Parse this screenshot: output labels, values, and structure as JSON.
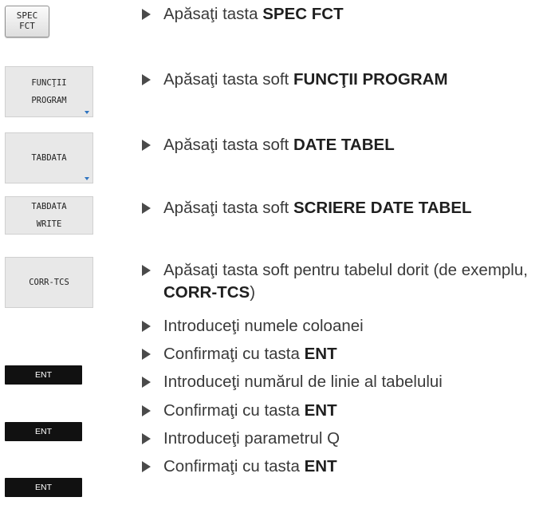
{
  "keys": {
    "spec_fct": {
      "line1": "SPEC",
      "line2": "FCT"
    },
    "program_functions": {
      "line1": "FUNCŢII",
      "line2": "PROGRAM"
    },
    "tabdata": {
      "line1": "TABDATA"
    },
    "tabdata_write": {
      "line1": "TABDATA",
      "line2": "WRITE"
    },
    "corr_tcs": {
      "line1": "CORR-TCS"
    },
    "ent": "ENT"
  },
  "steps": [
    {
      "text": "Apăsaţi tasta ",
      "bold": "SPEC FCT",
      "after": ""
    },
    {
      "text": "Apăsaţi tasta soft ",
      "bold": "FUNCŢII PROGRAM",
      "after": ""
    },
    {
      "text": "Apăsaţi tasta soft ",
      "bold": "DATE TABEL",
      "after": ""
    },
    {
      "text": "Apăsaţi tasta soft ",
      "bold": "SCRIERE DATE TABEL",
      "after": ""
    },
    {
      "text": "Apăsaţi tasta soft pentru tabelul dorit (de exemplu, ",
      "bold": "CORR-TCS",
      "after": ")"
    },
    {
      "text": "Introduceţi numele coloanei",
      "bold": "",
      "after": ""
    },
    {
      "text": "Confirmaţi cu tasta ",
      "bold": "ENT",
      "after": ""
    },
    {
      "text": "Introduceţi numărul de linie al tabelului",
      "bold": "",
      "after": ""
    },
    {
      "text": "Confirmaţi cu tasta ",
      "bold": "ENT",
      "after": ""
    },
    {
      "text": "Introduceţi parametrul Q",
      "bold": "",
      "after": ""
    },
    {
      "text": "Confirmaţi cu tasta ",
      "bold": "ENT",
      "after": ""
    }
  ],
  "colors": {
    "ent_key_bg": "#111111",
    "softkey_bg": "#e8e8e8",
    "softkey_arrow": "#2f74c0",
    "bullet": "#4a4a4a"
  }
}
